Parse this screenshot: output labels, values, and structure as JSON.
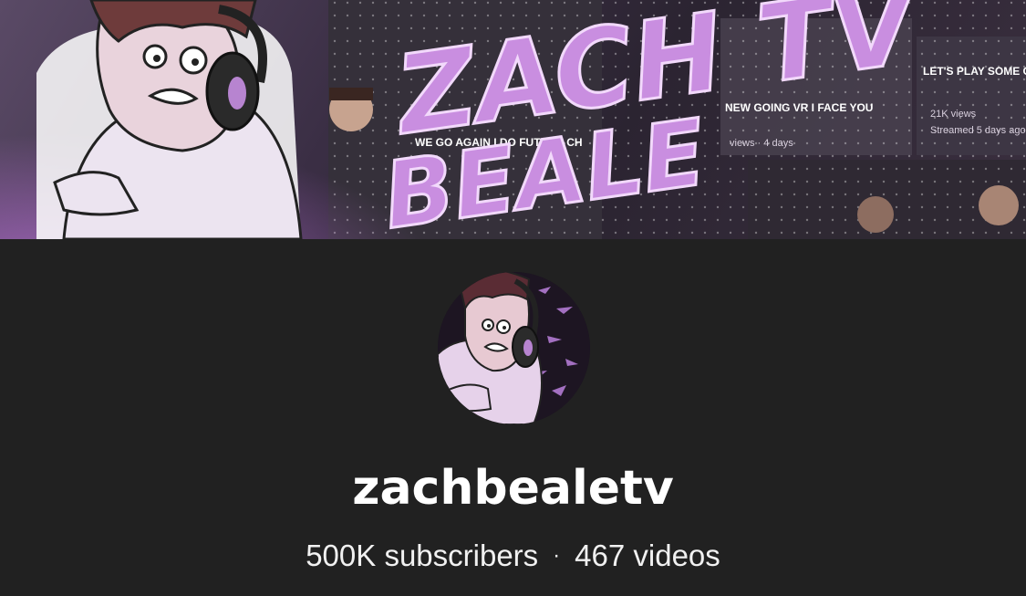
{
  "banner": {
    "title_line1": "ZACH TV",
    "title_line2": "BEALE",
    "thumb_titles": [
      "LET'S PLAY SOME GAMES LIVE!!!",
      "NEW GOING VR I FACE YOU",
      "WE GO AGAIN I DO FUTURE CH"
    ],
    "thumb_meta": [
      "21K views",
      "Streamed 5 days ago",
      "views · 4 days"
    ],
    "accent_color": "#c98ee0"
  },
  "avatar": {
    "icon": "cartoon-face-avatar"
  },
  "channel": {
    "name": "zachbealetv",
    "subscribers": "500K subscribers",
    "separator": "·",
    "videos": "467 videos"
  }
}
